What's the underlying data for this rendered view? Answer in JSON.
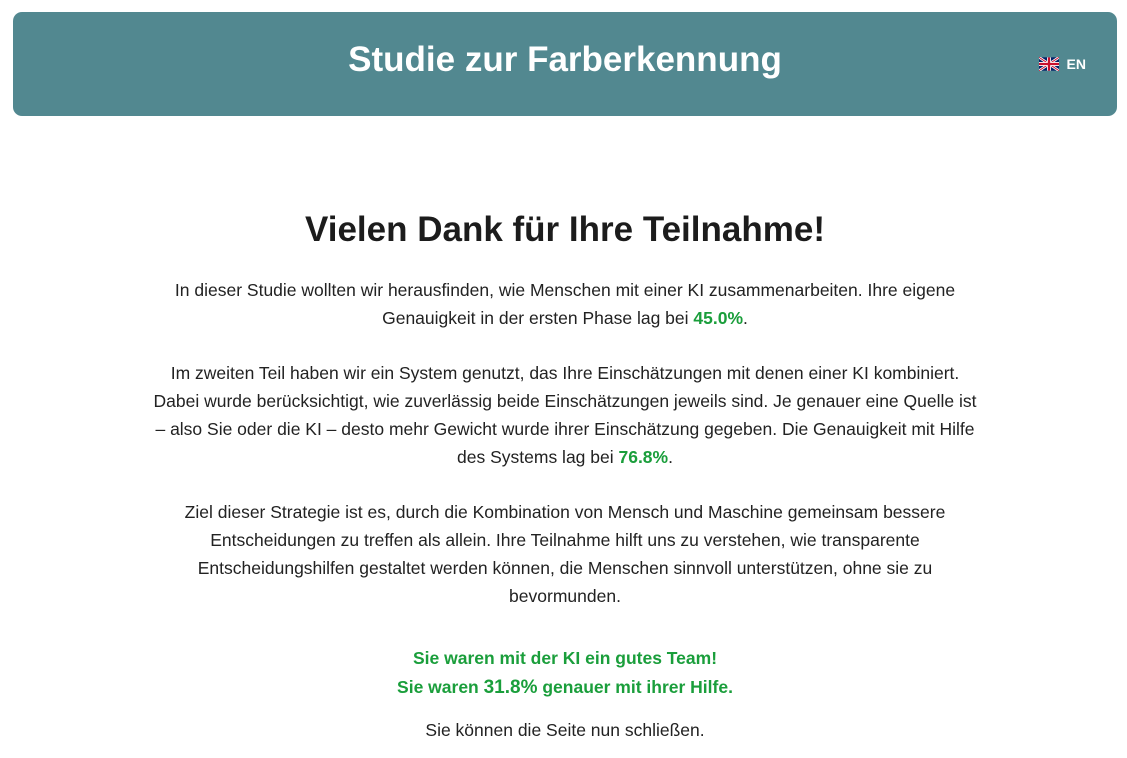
{
  "header": {
    "title": "Studie zur Farberkennung",
    "language_label": "EN",
    "flag_icon": "uk-flag-icon"
  },
  "main": {
    "heading": "Vielen Dank für Ihre Teilnahme!",
    "p1_before": "In dieser Studie wollten wir herausfinden, wie Menschen mit einer KI zusammenarbeiten. Ihre eigene Genauigkeit in der ersten Phase lag bei ",
    "p1_value": "45.0%",
    "p1_after": ".",
    "p2_before": "Im zweiten Teil haben wir ein System genutzt, das Ihre Einschätzungen mit denen einer KI kombiniert. Dabei wurde berücksichtigt, wie zuverlässig beide Einschätzungen jeweils sind. Je genauer eine Quelle ist – also Sie oder die KI – desto mehr Gewicht wurde ihrer Einschätzung gegeben. Die Genauigkeit mit Hilfe des Systems lag bei ",
    "p2_value": "76.8%",
    "p2_after": ".",
    "p3": "Ziel dieser Strategie ist es, durch die Kombination von Mensch und Maschine gemeinsam bessere Entscheidungen zu treffen als allein. Ihre Teilnahme hilft uns zu verstehen, wie transparente Entscheidungshilfen gestaltet werden können, die Menschen sinnvoll unterstützen, ohne sie zu bevormunden.",
    "team_line1": "Sie waren mit der KI ein gutes Team!",
    "team_line2_before": "Sie waren ",
    "team_line2_value": "31.8%",
    "team_line2_after": " genauer mit ihrer Hilfe.",
    "close_note": "Sie können die Seite nun schließen."
  },
  "colors": {
    "header_bg": "#528890",
    "highlight_green": "#1a9e3b",
    "text": "#222222"
  }
}
